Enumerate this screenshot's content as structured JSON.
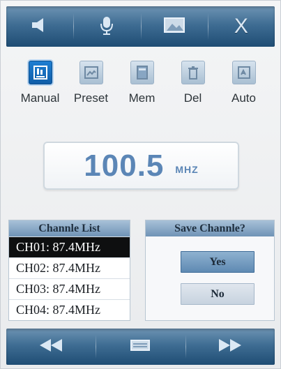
{
  "toolbar": {
    "buttons": [
      {
        "icon": "speaker-icon"
      },
      {
        "icon": "microphone-icon"
      },
      {
        "icon": "image-icon"
      },
      {
        "icon": "close-icon",
        "label": "X"
      }
    ]
  },
  "modes": [
    {
      "label": "Manual",
      "icon": "manual-icon",
      "active": true
    },
    {
      "label": "Preset",
      "icon": "preset-icon",
      "active": false
    },
    {
      "label": "Mem",
      "icon": "memory-icon",
      "active": false
    },
    {
      "label": "Del",
      "icon": "trash-icon",
      "active": false
    },
    {
      "label": "Auto",
      "icon": "auto-icon",
      "active": false
    }
  ],
  "frequency": {
    "value": "100.5",
    "unit": "MHZ"
  },
  "channel_list": {
    "title": "Channle List",
    "items": [
      {
        "label": "CH01: 87.4MHz",
        "selected": true
      },
      {
        "label": "CH02: 87.4MHz",
        "selected": false
      },
      {
        "label": "CH03: 87.4MHz",
        "selected": false
      },
      {
        "label": "CH04: 87.4MHz",
        "selected": false
      }
    ]
  },
  "save_dialog": {
    "title": "Save Channle?",
    "yes_label": "Yes",
    "no_label": "No"
  },
  "bottom": {
    "buttons": [
      {
        "icon": "rewind-icon"
      },
      {
        "icon": "menu-icon"
      },
      {
        "icon": "fast-forward-icon"
      }
    ]
  },
  "colors": {
    "accent": "#3f6d93",
    "highlight": "#0e0f10",
    "frequency": "#5b86b6"
  }
}
